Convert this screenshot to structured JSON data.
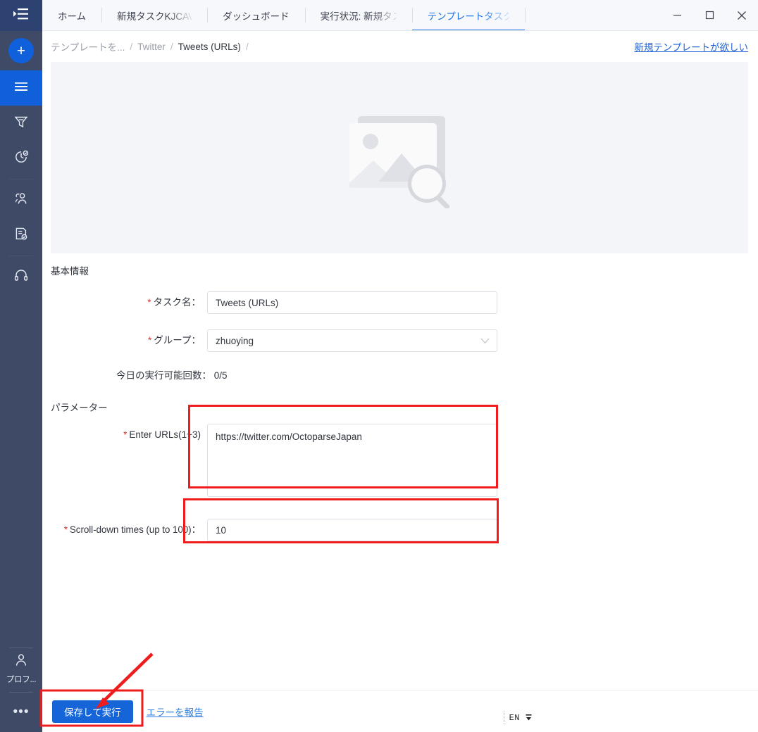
{
  "sidebar": {
    "toggle_icon": "menu-expand-icon",
    "new_button_label": "+",
    "items": [
      {
        "icon": "hamburger-icon",
        "name": "tasks",
        "active": true
      },
      {
        "icon": "funnel-icon",
        "name": "data-cleaning",
        "active": false
      },
      {
        "icon": "clock-check-icon",
        "name": "task-status",
        "active": false
      },
      {
        "icon": "people-icon",
        "name": "team",
        "active": false
      },
      {
        "icon": "document-check-icon",
        "name": "data-service",
        "active": false
      },
      {
        "icon": "headset-icon",
        "name": "support",
        "active": false
      }
    ],
    "profile_icon": "person-icon",
    "profile_label": "プロフ...",
    "more_label": "•••"
  },
  "tabs": [
    {
      "label": "ホーム",
      "active": false,
      "faded": false
    },
    {
      "label": "新規タスクKJCAVPEc",
      "active": false,
      "faded": true
    },
    {
      "label": "ダッシュボード",
      "active": false,
      "faded": false
    },
    {
      "label": "実行状況: 新規タスク",
      "active": false,
      "faded": true
    },
    {
      "label": "テンプレートタスク",
      "active": true,
      "faded": true
    }
  ],
  "window_controls": {
    "minimize": "minimize-icon",
    "maximize": "maximize-icon",
    "close": "close-icon"
  },
  "breadcrumb": {
    "items": [
      "テンプレートを...",
      "Twitter",
      "Tweets (URLs)"
    ],
    "separator": "/",
    "trailing_separator": "/"
  },
  "header_link": {
    "label": "新規テンプレートが欲しい"
  },
  "banner": {
    "placeholder_icon": "image-search-placeholder-icon"
  },
  "basic_info": {
    "section_title": "基本情報",
    "task_name": {
      "required_mark": "*",
      "label": "タスク名：",
      "value": "Tweets (URLs)"
    },
    "group": {
      "required_mark": "*",
      "label": "グループ：",
      "value": "zhuoying",
      "caret_icon": "chevron-down-icon"
    },
    "runs_today": "今日の実行可能回数： 0/5"
  },
  "parameters": {
    "section_title": "パラメーター",
    "urls": {
      "required_mark": "*",
      "label": "Enter URLs(1~3)",
      "value": "https://twitter.com/OctoparseJapan"
    },
    "scroll": {
      "required_mark": "*",
      "label": "Scroll-down times (up to 100)",
      "label_suffix": "：",
      "value": "10"
    }
  },
  "footer": {
    "save_run_label": "保存して実行",
    "report_error_label": "エラーを報告",
    "ime_label": "EN"
  },
  "colors": {
    "accent_blue": "#1565d8",
    "sidebar_bg": "#3e4a66",
    "sidebar_active": "#105fdb",
    "annotation_red": "#ee1c1c",
    "link_blue": "#2062d4",
    "banner_bg": "#f4f5f9"
  }
}
